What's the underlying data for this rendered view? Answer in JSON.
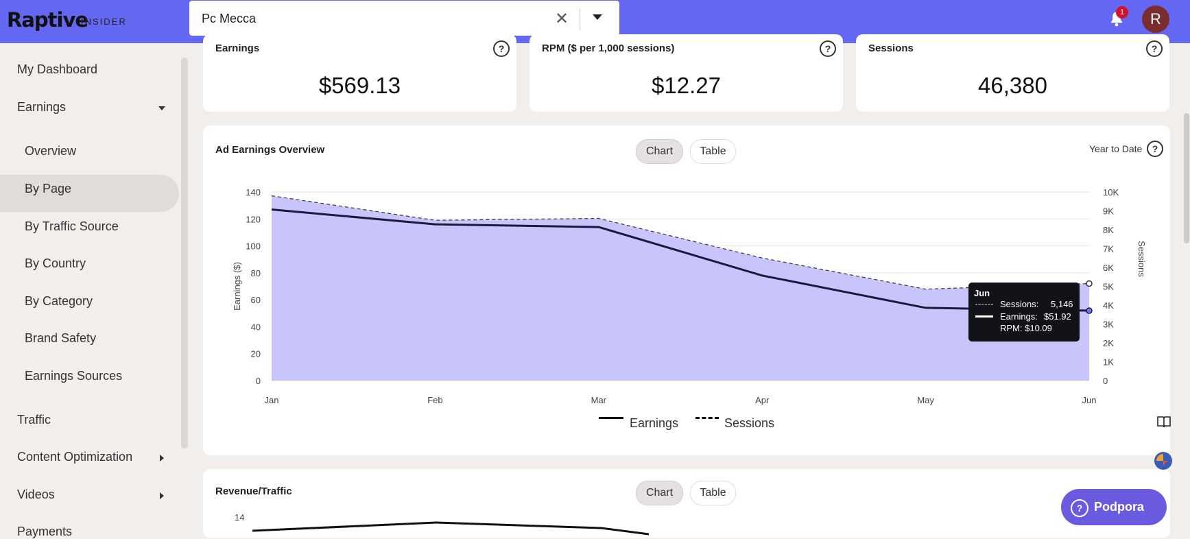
{
  "app": {
    "logo": "Raptive",
    "logo_sub": "INSIDER"
  },
  "search": {
    "value": "Pc Mecca"
  },
  "notifications": {
    "count": "1"
  },
  "user": {
    "initial": "R"
  },
  "sidebar": {
    "items": [
      {
        "label": "My Dashboard"
      },
      {
        "label": "Earnings"
      },
      {
        "label": "Overview"
      },
      {
        "label": "By Page"
      },
      {
        "label": "By Traffic Source"
      },
      {
        "label": "By Country"
      },
      {
        "label": "By Category"
      },
      {
        "label": "Brand Safety"
      },
      {
        "label": "Earnings Sources"
      },
      {
        "label": "Traffic"
      },
      {
        "label": "Content Optimization"
      },
      {
        "label": "Videos"
      },
      {
        "label": "Payments"
      }
    ]
  },
  "kpis": [
    {
      "title": "Earnings",
      "value": "$569.13"
    },
    {
      "title": "RPM ($ per 1,000 sessions)",
      "value": "$12.27"
    },
    {
      "title": "Sessions",
      "value": "46,380"
    }
  ],
  "overview": {
    "title": "Ad Earnings Overview",
    "tab_chart": "Chart",
    "tab_table": "Table",
    "range": "Year to Date"
  },
  "chart_data": {
    "type": "area",
    "title": "Ad Earnings Overview",
    "categories": [
      "Jan",
      "Feb",
      "Mar",
      "Apr",
      "May",
      "Jun"
    ],
    "ylabel": "Earnings ($)",
    "y2label": "Sessions",
    "ylim": [
      0,
      140
    ],
    "y2lim": [
      0,
      10000
    ],
    "yticks": [
      "0",
      "20",
      "40",
      "60",
      "80",
      "100",
      "120",
      "140"
    ],
    "y2ticks": [
      "0",
      "1K",
      "2K",
      "3K",
      "4K",
      "5K",
      "6K",
      "7K",
      "8K",
      "9K",
      "10K"
    ],
    "series": [
      {
        "name": "Earnings",
        "axis": "left",
        "values": [
          127,
          116,
          114,
          78,
          54,
          51.92
        ]
      },
      {
        "name": "Sessions",
        "axis": "right",
        "values": [
          9800,
          8500,
          8600,
          6500,
          4850,
          5146
        ]
      }
    ],
    "legend": [
      "Earnings",
      "Sessions"
    ],
    "tooltip": {
      "title": "Jun",
      "sessions_label": "Sessions:",
      "sessions_value": "5,146",
      "earnings_label": "Earnings:",
      "earnings_value": "$51.92",
      "rpm": "RPM: $10.09"
    },
    "colors": {
      "fill": "#c5c2fb",
      "line": "#1b1a3c"
    }
  },
  "revenue": {
    "title": "Revenue/Traffic",
    "tab_chart": "Chart",
    "tab_table": "Table",
    "ytick_top": "14"
  },
  "support": {
    "label": "Podpora"
  }
}
